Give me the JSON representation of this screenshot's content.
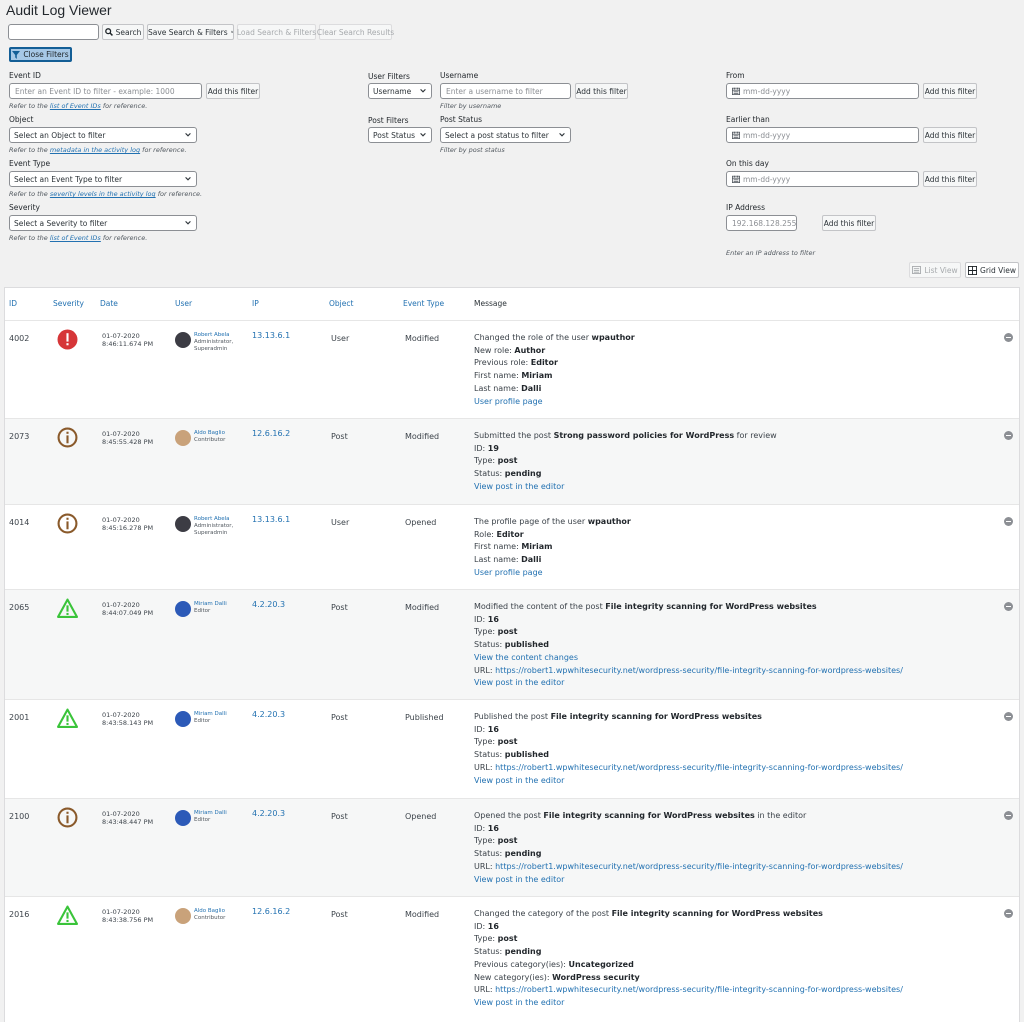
{
  "title": "Audit Log Viewer",
  "search": {
    "placeholder": "",
    "button": "Search",
    "save": "Save Search & Filters",
    "load": "Load Search & Filters",
    "clear": "Clear Search Results"
  },
  "close_filters": "Close Filters",
  "filters": {
    "event_id": {
      "label": "Event ID",
      "placeholder": "Enter an Event ID to filter - example: 1000",
      "add": "Add this filter",
      "hint_pre": "Refer to the ",
      "hint_link": "list of Event IDs",
      "hint_post": " for reference."
    },
    "object": {
      "label": "Object",
      "select": "Select an Object to filter",
      "hint_pre": "Refer to the ",
      "hint_link": "metadata in the activity log",
      "hint_post": " for reference."
    },
    "event_type": {
      "label": "Event Type",
      "select": "Select an Event Type to filter",
      "hint_pre": "Refer to the ",
      "hint_link": "severity levels in the activity log",
      "hint_post": " for reference."
    },
    "severity": {
      "label": "Severity",
      "select": "Select a Severity to filter",
      "hint_pre": "Refer to the ",
      "hint_link": "list of Event IDs",
      "hint_post": " for reference."
    },
    "user_filters": {
      "label": "User Filters",
      "select": "Username"
    },
    "username": {
      "label": "Username",
      "placeholder": "Enter a username to filter",
      "add": "Add this filter",
      "hint": "Filter by username"
    },
    "post_filters": {
      "label": "Post Filters",
      "select": "Post Status"
    },
    "post_status": {
      "label": "Post Status",
      "select": "Select a post status to filter",
      "hint": "Filter by post status"
    },
    "from": {
      "label": "From",
      "placeholder": "mm-dd-yyyy",
      "add": "Add this filter"
    },
    "earlier": {
      "label": "Earlier than",
      "placeholder": "mm-dd-yyyy",
      "add": "Add this filter"
    },
    "on_day": {
      "label": "On this day",
      "placeholder": "mm-dd-yyyy",
      "add": "Add this filter"
    },
    "ip": {
      "label": "IP Address",
      "placeholder": "192.168.128.255",
      "add": "Add this filter",
      "hint": "Enter an IP address to filter"
    }
  },
  "views": {
    "list": "List View",
    "grid": "Grid View"
  },
  "columns": [
    "ID",
    "Severity",
    "Date",
    "User",
    "IP",
    "Object",
    "Event Type",
    "Message"
  ],
  "colors": {
    "critical": "#d63638",
    "info": "#8a5a2b",
    "warning": "#3ac43a",
    "link": "#2271b1"
  },
  "rows": [
    {
      "id": "4002",
      "severity": "critical",
      "date": "01-07-2020",
      "time": "8:46:11.674 PM",
      "user": "Robert Abela",
      "role1": "Administrator,",
      "role2": "Superadmin",
      "avatar": "dark",
      "ip": "13.13.6.1",
      "object": "User",
      "event_type": "Modified",
      "lines": [
        [
          {
            "t": "Changed the role of the user "
          },
          {
            "b": "wpauthor"
          }
        ],
        [
          {
            "t": "New role: "
          },
          {
            "b": "Author"
          }
        ],
        [
          {
            "t": "Previous role: "
          },
          {
            "b": "Editor"
          }
        ],
        [
          {
            "t": "First name: "
          },
          {
            "b": "Miriam"
          }
        ],
        [
          {
            "t": "Last name: "
          },
          {
            "b": "Dalli"
          }
        ],
        [
          {
            "a": "User profile page"
          }
        ]
      ]
    },
    {
      "id": "2073",
      "severity": "info",
      "date": "01-07-2020",
      "time": "8:45:55.428 PM",
      "user": "Aldo Baglio",
      "role1": "Contributor",
      "role2": "",
      "avatar": "light",
      "ip": "12.6.16.2",
      "object": "Post",
      "event_type": "Modified",
      "lines": [
        [
          {
            "t": "Submitted the post "
          },
          {
            "b": "Strong password policies for WordPress"
          },
          {
            "t": " for review"
          }
        ],
        [
          {
            "t": "ID: "
          },
          {
            "b": "19"
          }
        ],
        [
          {
            "t": "Type: "
          },
          {
            "b": "post"
          }
        ],
        [
          {
            "t": "Status: "
          },
          {
            "b": "pending"
          }
        ],
        [
          {
            "a": "View post in the editor"
          }
        ]
      ]
    },
    {
      "id": "4014",
      "severity": "info",
      "date": "01-07-2020",
      "time": "8:45:16.278 PM",
      "user": "Robert Abela",
      "role1": "Administrator,",
      "role2": "Superadmin",
      "avatar": "dark",
      "ip": "13.13.6.1",
      "object": "User",
      "event_type": "Opened",
      "lines": [
        [
          {
            "t": "The profile page of the user "
          },
          {
            "b": "wpauthor"
          }
        ],
        [
          {
            "t": "Role: "
          },
          {
            "b": "Editor"
          }
        ],
        [
          {
            "t": "First name: "
          },
          {
            "b": "Miriam"
          }
        ],
        [
          {
            "t": "Last name: "
          },
          {
            "b": "Dalli"
          }
        ],
        [
          {
            "a": "User profile page"
          }
        ]
      ]
    },
    {
      "id": "2065",
      "severity": "warning",
      "date": "01-07-2020",
      "time": "8:44:07.049 PM",
      "user": "Miriam Dalli",
      "role1": "Editor",
      "role2": "",
      "avatar": "blue",
      "ip": "4.2.20.3",
      "object": "Post",
      "event_type": "Modified",
      "lines": [
        [
          {
            "t": "Modified the content of the post "
          },
          {
            "b": "File integrity scanning for WordPress websites"
          }
        ],
        [
          {
            "t": "ID: "
          },
          {
            "b": "16"
          }
        ],
        [
          {
            "t": "Type: "
          },
          {
            "b": "post"
          }
        ],
        [
          {
            "t": "Status: "
          },
          {
            "b": "published"
          }
        ],
        [
          {
            "a": "View the content changes"
          }
        ],
        [
          {
            "t": "URL: "
          },
          {
            "a": "https://robert1.wpwhitesecurity.net/wordpress-security/file-integrity-scanning-for-wordpress-websites/"
          }
        ],
        [
          {
            "a": "View post in the editor"
          }
        ]
      ]
    },
    {
      "id": "2001",
      "severity": "warning",
      "date": "01-07-2020",
      "time": "8:43:58.143 PM",
      "user": "Miriam Dalli",
      "role1": "Editor",
      "role2": "",
      "avatar": "blue",
      "ip": "4.2.20.3",
      "object": "Post",
      "event_type": "Published",
      "lines": [
        [
          {
            "t": "Published the post "
          },
          {
            "b": "File integrity scanning for WordPress websites"
          }
        ],
        [
          {
            "t": "ID: "
          },
          {
            "b": "16"
          }
        ],
        [
          {
            "t": "Type: "
          },
          {
            "b": "post"
          }
        ],
        [
          {
            "t": "Status: "
          },
          {
            "b": "published"
          }
        ],
        [
          {
            "t": "URL: "
          },
          {
            "a": "https://robert1.wpwhitesecurity.net/wordpress-security/file-integrity-scanning-for-wordpress-websites/"
          }
        ],
        [
          {
            "a": "View post in the editor"
          }
        ]
      ]
    },
    {
      "id": "2100",
      "severity": "info",
      "date": "01-07-2020",
      "time": "8:43:48.447 PM",
      "user": "Miriam Dalli",
      "role1": "Editor",
      "role2": "",
      "avatar": "blue",
      "ip": "4.2.20.3",
      "object": "Post",
      "event_type": "Opened",
      "lines": [
        [
          {
            "t": "Opened the post "
          },
          {
            "b": "File integrity scanning for WordPress websites"
          },
          {
            "t": " in the editor"
          }
        ],
        [
          {
            "t": "ID: "
          },
          {
            "b": "16"
          }
        ],
        [
          {
            "t": "Type: "
          },
          {
            "b": "post"
          }
        ],
        [
          {
            "t": "Status: "
          },
          {
            "b": "pending"
          }
        ],
        [
          {
            "t": "URL: "
          },
          {
            "a": "https://robert1.wpwhitesecurity.net/wordpress-security/file-integrity-scanning-for-wordpress-websites/"
          }
        ],
        [
          {
            "a": "View post in the editor"
          }
        ]
      ]
    },
    {
      "id": "2016",
      "severity": "warning",
      "date": "01-07-2020",
      "time": "8:43:38.756 PM",
      "user": "Aldo Baglio",
      "role1": "Contributor",
      "role2": "",
      "avatar": "light",
      "ip": "12.6.16.2",
      "object": "Post",
      "event_type": "Modified",
      "lines": [
        [
          {
            "t": "Changed the category of the post "
          },
          {
            "b": "File integrity scanning for WordPress websites"
          }
        ],
        [
          {
            "t": "ID: "
          },
          {
            "b": "16"
          }
        ],
        [
          {
            "t": "Type: "
          },
          {
            "b": "post"
          }
        ],
        [
          {
            "t": "Status: "
          },
          {
            "b": "pending"
          }
        ],
        [
          {
            "t": "Previous category(ies): "
          },
          {
            "b": "Uncategorized"
          }
        ],
        [
          {
            "t": "New category(ies): "
          },
          {
            "b": "WordPress security"
          }
        ],
        [
          {
            "t": "URL: "
          },
          {
            "a": "https://robert1.wpwhitesecurity.net/wordpress-security/file-integrity-scanning-for-wordpress-websites/"
          }
        ],
        [
          {
            "a": "View post in the editor"
          }
        ]
      ]
    }
  ]
}
